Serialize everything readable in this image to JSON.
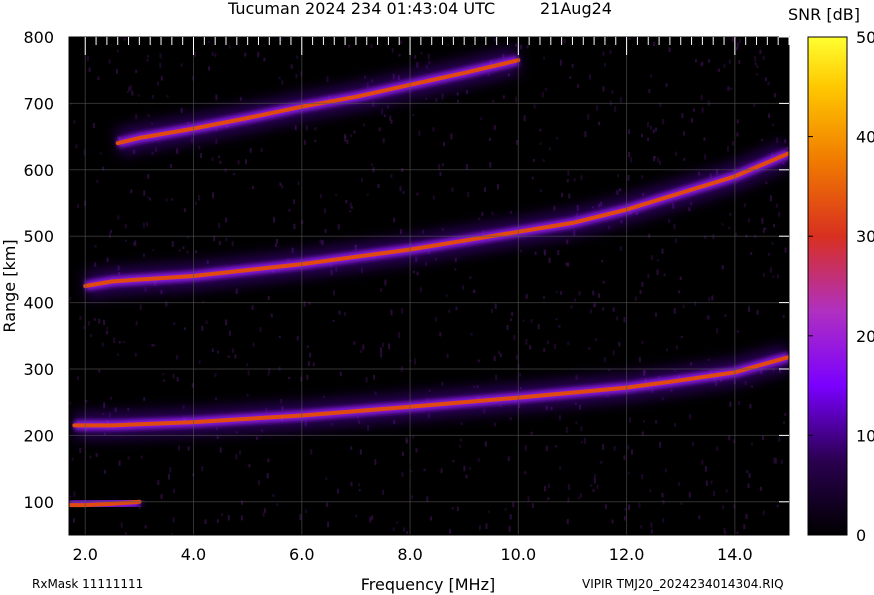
{
  "chart_data": {
    "type": "heatmap",
    "title": "Tucuman 2024 234 01:43:04 UTC",
    "date_label": "21Aug24",
    "xlabel": "Frequency [MHz]",
    "ylabel": "Range [km]",
    "xlim": [
      1.7,
      15.0
    ],
    "ylim": [
      50,
      800
    ],
    "x_ticks": [
      "2.0",
      "4.0",
      "6.0",
      "8.0",
      "10.0",
      "12.0",
      "14.0"
    ],
    "x_tick_values": [
      2,
      4,
      6,
      8,
      10,
      12,
      14
    ],
    "y_ticks": [
      "100",
      "200",
      "300",
      "400",
      "500",
      "600",
      "700",
      "800"
    ],
    "y_tick_values": [
      100,
      200,
      300,
      400,
      500,
      600,
      700,
      800
    ],
    "grid": true,
    "colorbar": {
      "label": "SNR [dB]",
      "range": [
        0,
        50
      ],
      "ticks": [
        "0",
        "10",
        "20",
        "30",
        "40",
        "50"
      ],
      "tick_values": [
        0,
        10,
        20,
        30,
        40,
        50
      ]
    },
    "traces": [
      {
        "points": [
          [
            1.7,
            95
          ],
          [
            2.0,
            95
          ],
          [
            2.5,
            97
          ],
          [
            3.0,
            100
          ]
        ],
        "snr": 30
      },
      {
        "points": [
          [
            1.8,
            215
          ],
          [
            2.5,
            215
          ],
          [
            4.0,
            220
          ],
          [
            6.0,
            230
          ],
          [
            8.0,
            243
          ],
          [
            10.0,
            257
          ],
          [
            12.0,
            272
          ],
          [
            13.0,
            283
          ],
          [
            14.0,
            295
          ],
          [
            15.0,
            318
          ]
        ],
        "snr": 32
      },
      {
        "points": [
          [
            2.0,
            425
          ],
          [
            2.5,
            432
          ],
          [
            4.0,
            440
          ],
          [
            6.0,
            458
          ],
          [
            8.0,
            480
          ],
          [
            9.5,
            500
          ],
          [
            11.0,
            520
          ],
          [
            12.0,
            540
          ],
          [
            13.0,
            565
          ],
          [
            14.0,
            590
          ],
          [
            15.0,
            625
          ]
        ],
        "snr": 32
      },
      {
        "points": [
          [
            2.6,
            640
          ],
          [
            3.0,
            648
          ],
          [
            4.0,
            662
          ],
          [
            5.0,
            678
          ],
          [
            6.0,
            695
          ],
          [
            7.0,
            710
          ],
          [
            8.0,
            728
          ],
          [
            9.0,
            746
          ],
          [
            10.0,
            765
          ]
        ],
        "snr": 30
      }
    ]
  },
  "footer": {
    "rxmask": "RxMask 11111111",
    "filename": "VIPIR  TMJ20_2024234014304.RIQ"
  }
}
